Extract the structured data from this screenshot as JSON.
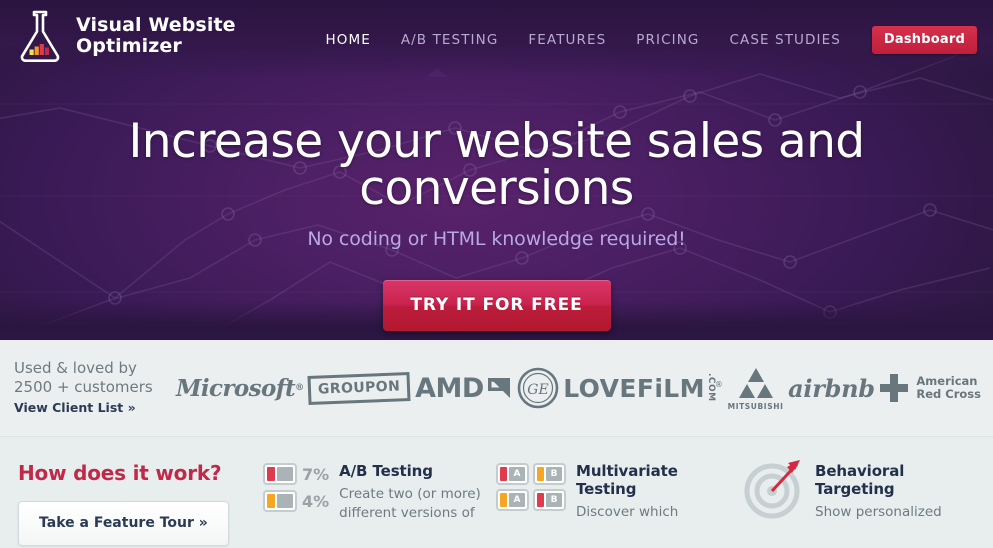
{
  "brand": {
    "logo_icon": "flask-icon",
    "name_line1": "Visual Website",
    "name_line2": "Optimizer",
    "accent_red": "#c0294a",
    "accent_purple": "#4a1f63",
    "cta_pink": "#c9234d"
  },
  "nav": {
    "items": [
      {
        "label": "HOME",
        "active": true
      },
      {
        "label": "A/B TESTING",
        "active": false
      },
      {
        "label": "FEATURES",
        "active": false
      },
      {
        "label": "PRICING",
        "active": false
      },
      {
        "label": "CASE STUDIES",
        "active": false
      }
    ],
    "dashboard_label": "Dashboard"
  },
  "hero": {
    "headline": "Increase your website sales and conversions",
    "subheadline": "No coding or HTML knowledge required!",
    "cta_label": "TRY IT FOR FREE"
  },
  "clients": {
    "label_line1": "Used & loved by",
    "label_line2": "2500 + customers",
    "view_list_label": "View Client List »",
    "logos": [
      {
        "name": "Microsoft",
        "icon": "microsoft-logo"
      },
      {
        "name": "GROUPON",
        "icon": "groupon-logo"
      },
      {
        "name": "AMD",
        "icon": "amd-logo"
      },
      {
        "name": "GE",
        "icon": "ge-logo"
      },
      {
        "name": "LOVEFiLM",
        "sub": ".COM",
        "icon": "lovefilm-logo"
      },
      {
        "name": "MITSUBISHI",
        "icon": "mitsubishi-logo"
      },
      {
        "name": "airbnb",
        "icon": "airbnb-logo"
      },
      {
        "name": "American Red Cross",
        "line1": "American",
        "line2": "Red Cross",
        "icon": "red-cross-logo"
      }
    ]
  },
  "how_it_works": {
    "title": "How does it work?",
    "tour_button_label": "Take a Feature Tour »",
    "features": [
      {
        "id": "ab-testing",
        "title": "A/B Testing",
        "description": "Create two (or more) different versions of",
        "icon": "ab-split-icon",
        "stats": [
          {
            "pct": "7%",
            "color": "#e03a4e"
          },
          {
            "pct": "4%",
            "color": "#f5a623"
          }
        ]
      },
      {
        "id": "multivariate-testing",
        "title": "Multivariate Testing",
        "description": "Discover which",
        "icon": "multivariate-grid-icon",
        "cells": [
          {
            "letter": "A",
            "color": "#e03a4e"
          },
          {
            "letter": "B",
            "color": "#f5a623"
          },
          {
            "letter": "A",
            "color": "#f5a623"
          },
          {
            "letter": "B",
            "color": "#e03a4e"
          }
        ]
      },
      {
        "id": "behavioral-targeting",
        "title": "Behavioral Targeting",
        "description": "Show personalized",
        "icon": "target-arrow-icon"
      }
    ]
  }
}
